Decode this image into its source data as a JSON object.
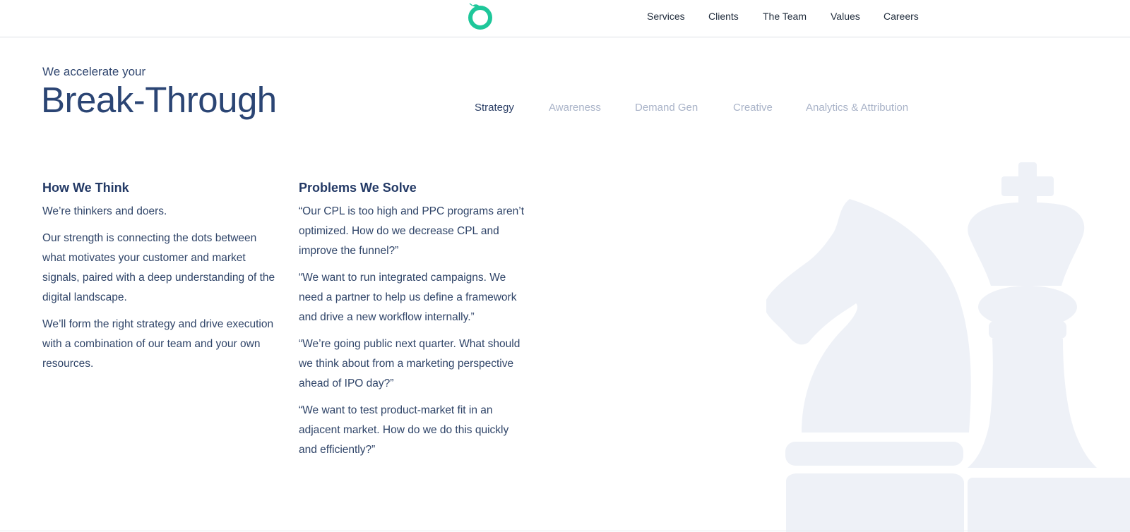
{
  "header": {
    "logo_icon": "circle-leaf-logo-icon",
    "brand_color": "#1ec79a",
    "nav": [
      "Services",
      "Clients",
      "The Team",
      "Values",
      "Careers"
    ]
  },
  "hero": {
    "kicker": "We accelerate your",
    "title": "Break-Through"
  },
  "tabs": {
    "items": [
      "Strategy",
      "Awareness",
      "Demand Gen",
      "Creative",
      "Analytics & Attribution"
    ],
    "active": "Strategy",
    "active_color": "#2b3f66",
    "inactive_color": "#a9b3c8"
  },
  "how_we_think": {
    "heading": "How We Think",
    "paragraphs": [
      "We’re thinkers and doers.",
      "Our strength is connecting the dots between what motivates your customer and market signals, paired with a deep understanding of the digital landscape.",
      "We’ll form the right strategy and drive execution with a combination of our team and your own resources."
    ]
  },
  "problems_we_solve": {
    "heading": "Problems We Solve",
    "paragraphs": [
      "“Our CPL is too high and PPC programs aren’t optimized. How do we decrease CPL and improve the funnel?”",
      "“We want to run integrated campaigns. We need a partner to help us define a framework and drive a new workflow internally.”",
      "“We’re going public next quarter. What should we think about from a marketing perspective ahead of IPO day?”",
      "“We want to test product-market fit in an adjacent market. How do we do this quickly and efficiently?”"
    ]
  },
  "decor": {
    "illustration_icon": "chess-knight-king-illustration",
    "illustration_color": "#eef1f7"
  }
}
